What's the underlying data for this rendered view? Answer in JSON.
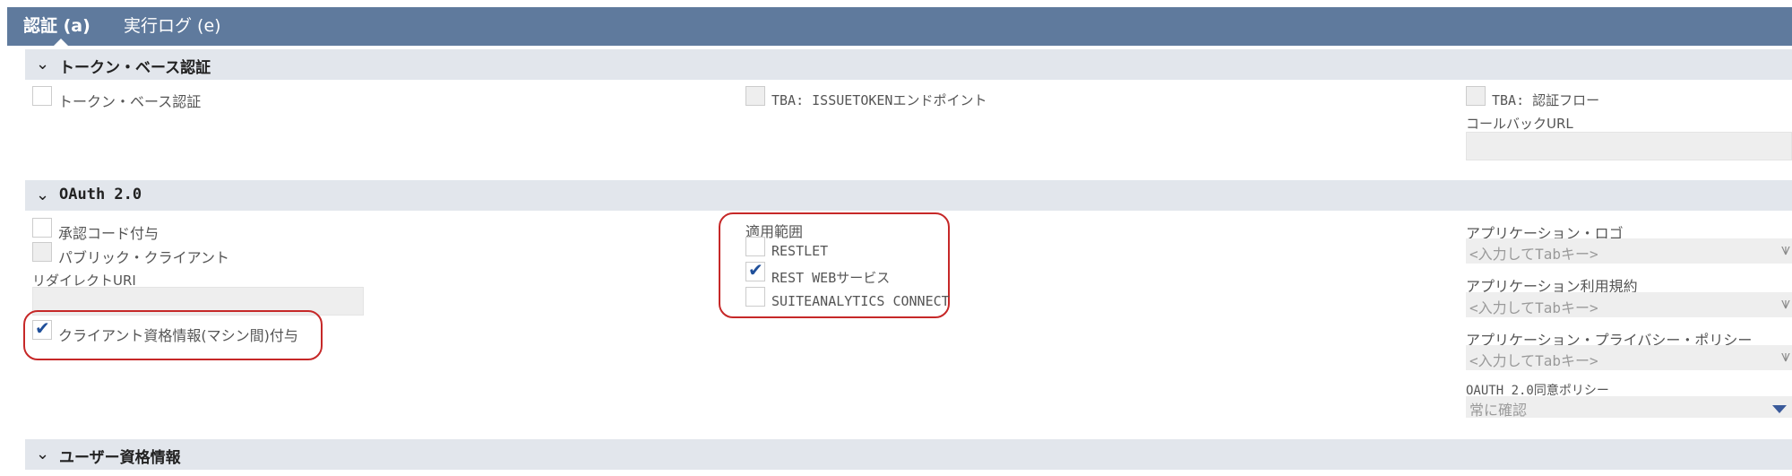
{
  "tabs": [
    {
      "label": "認証 (a)",
      "active": true
    },
    {
      "label": "実行ログ (e)",
      "active": false
    }
  ],
  "sections": {
    "tba": {
      "title": "トークン・ベース認証",
      "token_based_auth": "トークン・ベース認証",
      "issuetoken_endpoint": "TBA: ISSUETOKENエンドポイント",
      "auth_flow": "TBA: 認証フロー",
      "callback_url_label": "コールバックURL"
    },
    "oauth": {
      "title": "OAuth 2.0",
      "auth_code_grant": "承認コード付与",
      "public_client": "パブリック・クライアント",
      "redirect_uri_label": "リダイレクトURI",
      "client_credentials": "クライアント資格情報(マシン間)付与",
      "scope_label": "適用範囲",
      "scope_restlet": "RESTLET",
      "scope_rest_web": "REST WEBサービス",
      "scope_suiteanalytics": "SUITEANALYTICS CONNECT",
      "app_logo_label": "アプリケーション・ロゴ",
      "app_logo_placeholder": "<入力してTabキー>",
      "app_terms_label": "アプリケーション利用規約",
      "app_terms_placeholder": "<入力してTabキー>",
      "app_privacy_label": "アプリケーション・プライバシー・ポリシー",
      "app_privacy_placeholder": "<入力してTabキー>",
      "consent_policy_label": "OAUTH 2.0同意ポリシー",
      "consent_policy_value": "常に確認"
    },
    "user_credentials": {
      "title": "ユーザー資格情報"
    }
  },
  "checked": {
    "client_credentials": true,
    "scope_rest_web": true
  },
  "colors": {
    "tab_bar": "#5f7a9d",
    "section_header": "#e2e6ec",
    "highlight": "#c62828",
    "checkmark": "#1f4f9a"
  }
}
